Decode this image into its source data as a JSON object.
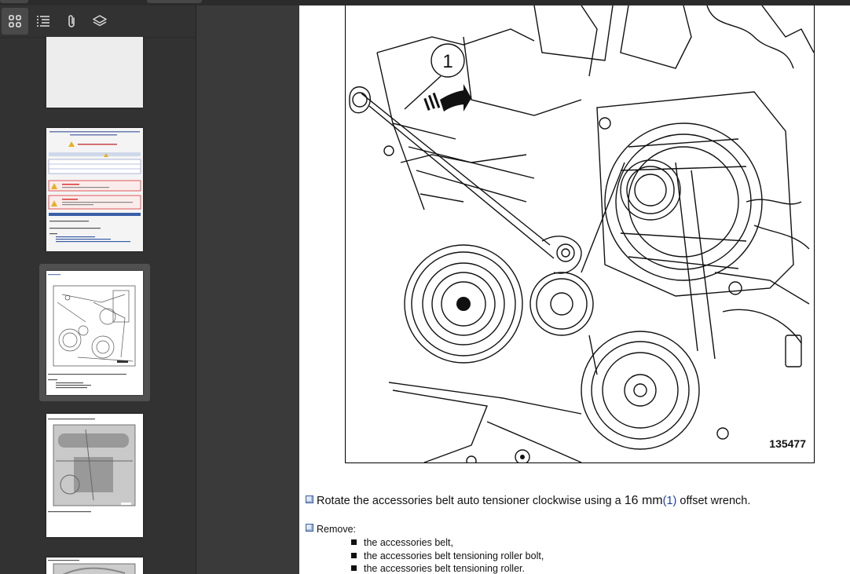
{
  "sidebar": {
    "toolbar": [
      {
        "id": "thumbnails",
        "icon": "thumbnails-icon",
        "active": true
      },
      {
        "id": "outline",
        "icon": "outline-list-icon",
        "active": false
      },
      {
        "id": "attachments",
        "icon": "paperclip-icon",
        "active": false
      },
      {
        "id": "layers",
        "icon": "layers-icon",
        "active": false
      }
    ]
  },
  "page": {
    "figure_number": "135477",
    "callout": "1",
    "step1": {
      "prefix": "Rotate the accessories belt auto tensioner clockwise using a ",
      "size": "16 mm",
      "ref": "(1)",
      "suffix": " offset wrench."
    },
    "step2": {
      "label": "Remove:",
      "items": [
        "the accessories belt,",
        "the accessories belt tensioning roller bolt,",
        "the accessories belt tensioning roller."
      ]
    }
  },
  "colors": {
    "sidebar_bg": "#323232",
    "viewer_bg": "#3a3a3a",
    "accent": "#1a3fa0"
  }
}
